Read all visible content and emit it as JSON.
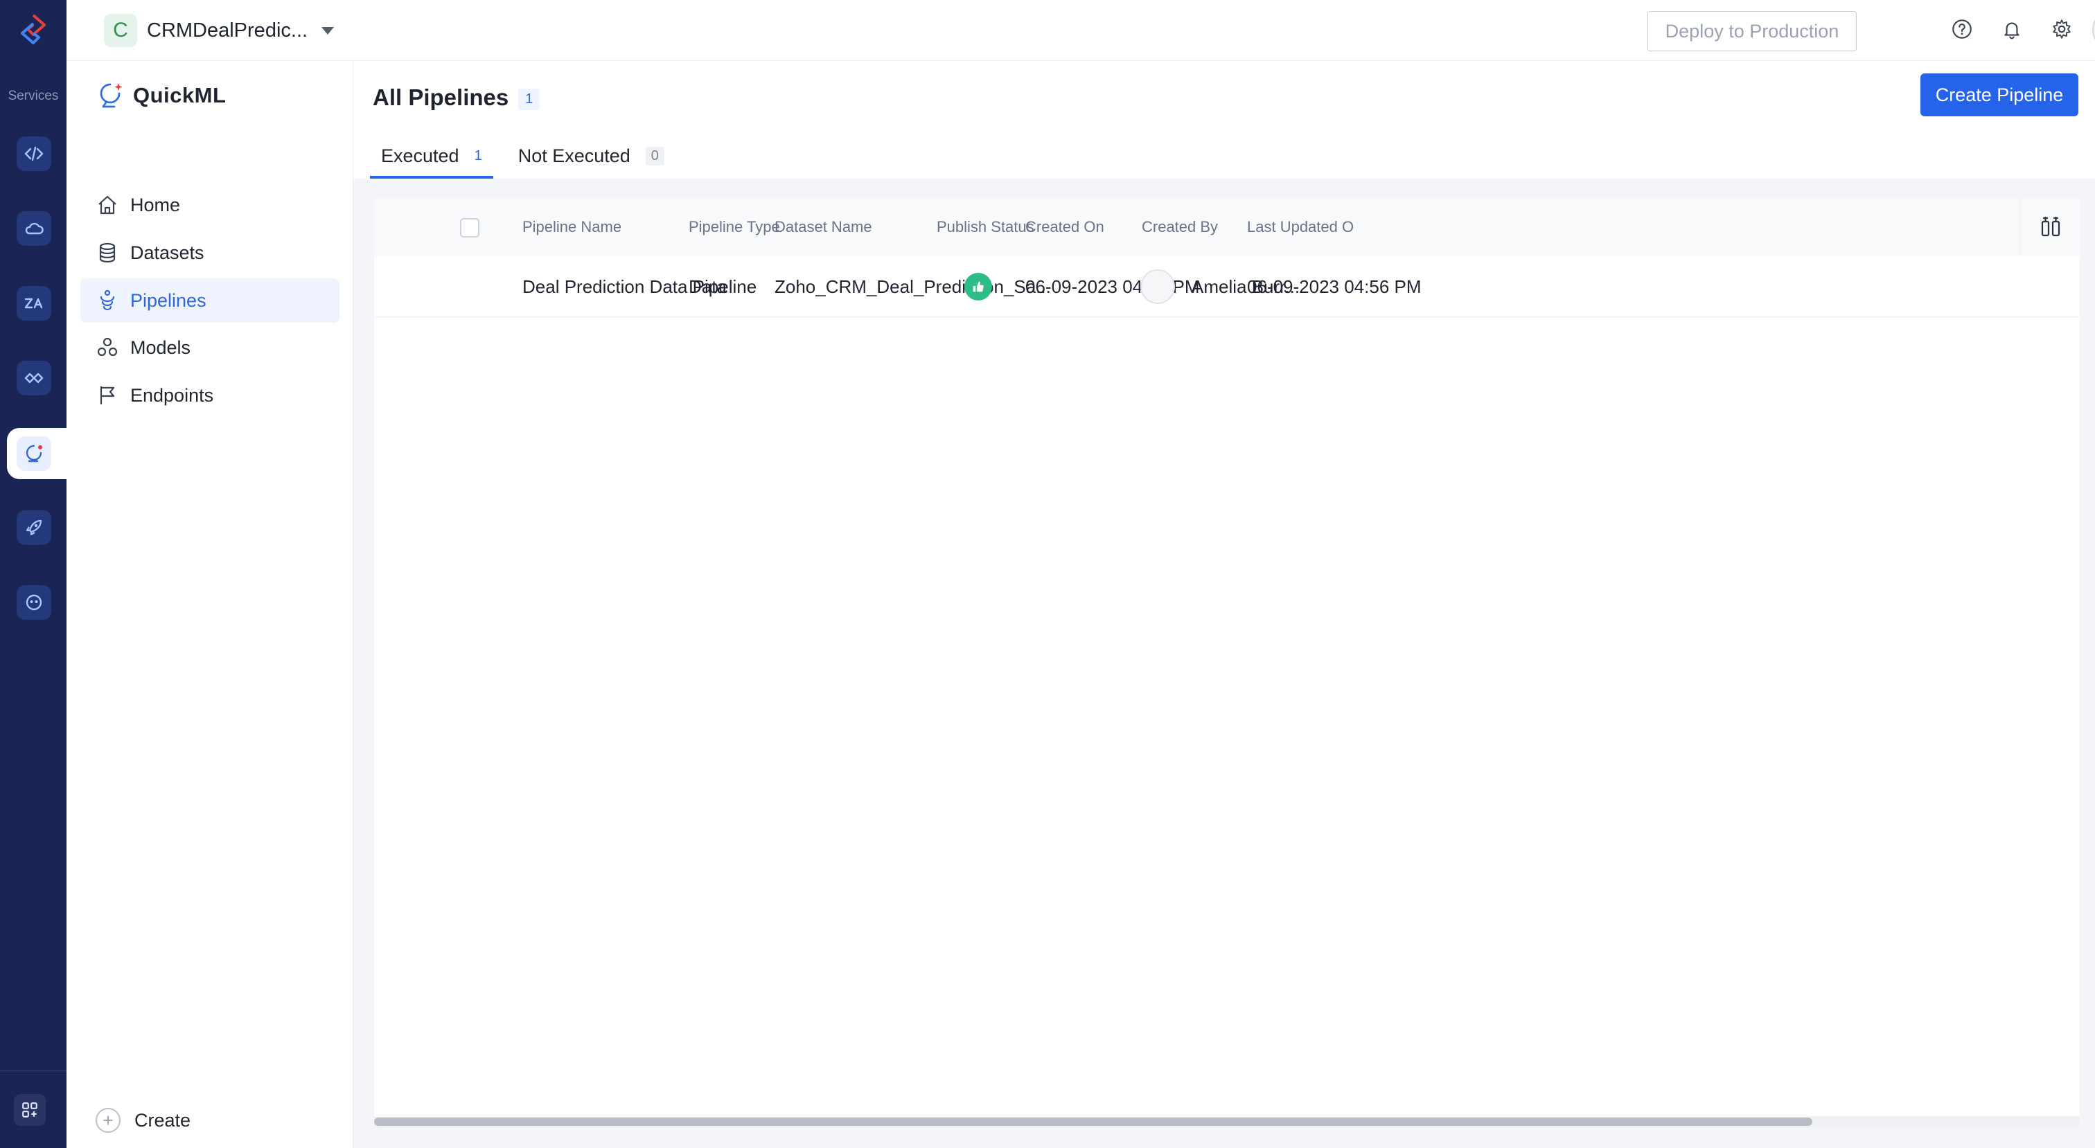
{
  "rail": {
    "label": "Services",
    "items": [
      "code-icon",
      "cloud-icon",
      "zia-icon",
      "handshake-icon",
      "quickml-icon",
      "rocket-icon",
      "bot-icon"
    ],
    "active_index": 4
  },
  "topbar": {
    "project_initial": "C",
    "project_name": "CRMDealPredic...",
    "deploy_label": "Deploy to Production"
  },
  "sidebar": {
    "brand": "QuickML",
    "items": [
      {
        "label": "Home",
        "icon": "home-icon"
      },
      {
        "label": "Datasets",
        "icon": "database-icon"
      },
      {
        "label": "Pipelines",
        "icon": "pipeline-icon",
        "active": true
      },
      {
        "label": "Models",
        "icon": "models-icon"
      },
      {
        "label": "Endpoints",
        "icon": "flag-icon"
      }
    ],
    "create_label": "Create"
  },
  "main": {
    "title": "All Pipelines",
    "title_count": "1",
    "create_button": "Create Pipeline",
    "tabs": [
      {
        "label": "Executed",
        "count": "1",
        "active": true
      },
      {
        "label": "Not Executed",
        "count": "0",
        "active": false
      }
    ],
    "table": {
      "columns": [
        "Pipeline Name",
        "Pipeline Type",
        "Dataset Name",
        "Publish Status",
        "Created On",
        "Created By",
        "Last Updated O"
      ],
      "rows": [
        {
          "pipeline_name": "Deal Prediction Data Pipeline",
          "pipeline_type": "Data",
          "dataset_name": "Zoho_CRM_Deal_Prediction_Sa...",
          "publish_status_icon": "thumbs-up-icon",
          "created_on": "06-09-2023 04:52 PM",
          "created_by": "Amelia Burr...",
          "last_updated_on": "06-09-2023 04:56 PM"
        }
      ]
    }
  },
  "colors": {
    "rail_bg": "#1a2555",
    "accent": "#2563eb",
    "success": "#2ebd85"
  }
}
